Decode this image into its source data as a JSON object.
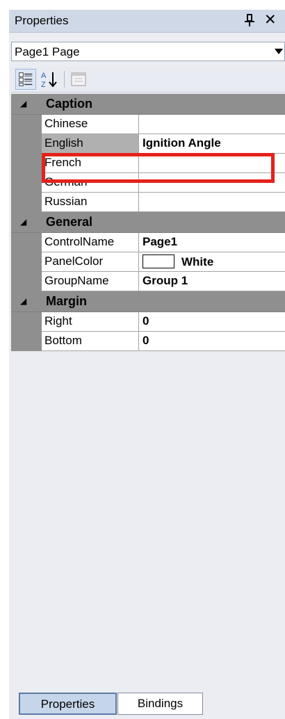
{
  "panel": {
    "title": "Properties"
  },
  "selector": {
    "value": "Page1 Page"
  },
  "categories": [
    {
      "title": "Caption",
      "rows": [
        {
          "name": "Chinese",
          "value": ""
        },
        {
          "name": "English",
          "value": "Ignition Angle"
        },
        {
          "name": "French",
          "value": ""
        },
        {
          "name": "German",
          "value": ""
        },
        {
          "name": "Russian",
          "value": ""
        }
      ]
    },
    {
      "title": "General",
      "rows": [
        {
          "name": "ControlName",
          "value": "Page1"
        },
        {
          "name": "PanelColor",
          "value": "White"
        },
        {
          "name": "GroupName",
          "value": "Group 1"
        }
      ]
    },
    {
      "title": "Margin",
      "rows": [
        {
          "name": "Right",
          "value": "0"
        },
        {
          "name": "Bottom",
          "value": "0"
        }
      ]
    }
  ],
  "tabs": [
    {
      "label": "Properties"
    },
    {
      "label": "Bindings"
    }
  ],
  "colors": {
    "highlight": "#e5211c",
    "category_bg": "#8f8f8f",
    "titlebar_bg": "#cfd8e6"
  }
}
